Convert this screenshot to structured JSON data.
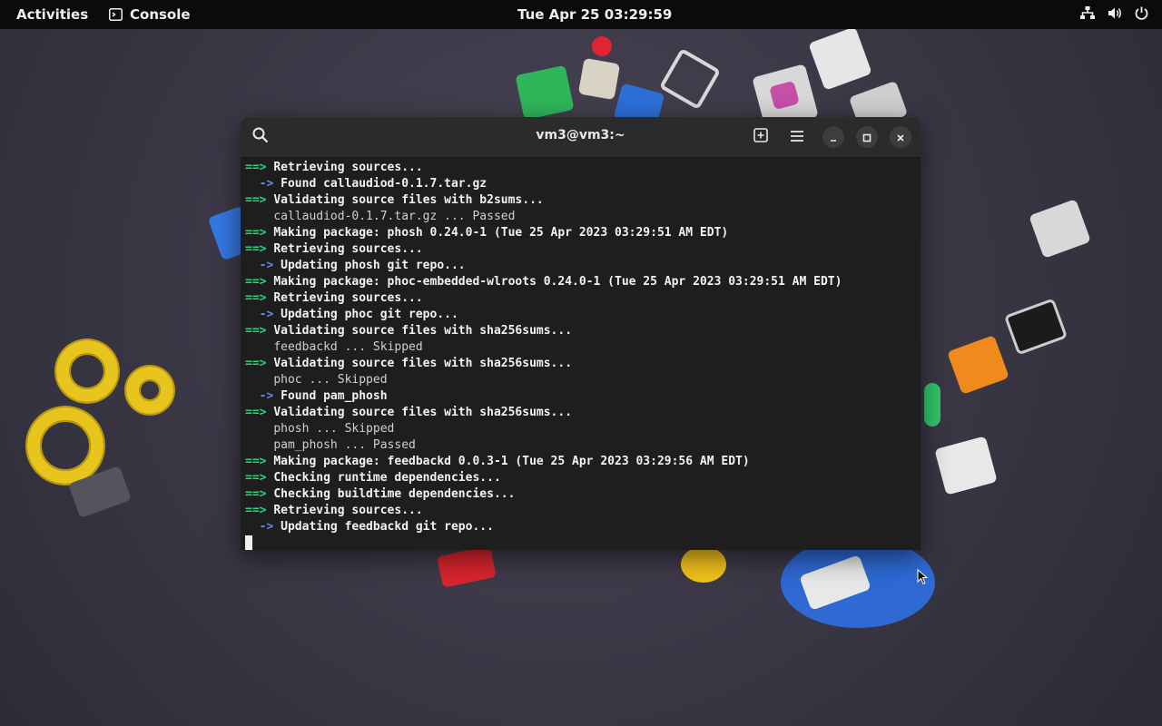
{
  "topbar": {
    "activities": "Activities",
    "app_name": "Console",
    "clock": "Tue Apr 25  03:29:59",
    "tray_icons": [
      "network-icon",
      "volume-icon",
      "power-icon"
    ]
  },
  "window": {
    "title": "vm3@vm3:~"
  },
  "terminal": {
    "lines": [
      {
        "marker": "==>",
        "type": "main",
        "text": "Retrieving sources..."
      },
      {
        "marker": "->",
        "type": "sub",
        "text": "Found callaudiod-0.1.7.tar.gz"
      },
      {
        "marker": "==>",
        "type": "main",
        "text": "Validating source files with b2sums..."
      },
      {
        "marker": "",
        "type": "plain",
        "text": "callaudiod-0.1.7.tar.gz ... Passed"
      },
      {
        "marker": "==>",
        "type": "main",
        "text": "Making package: phosh 0.24.0-1 (Tue 25 Apr 2023 03:29:51 AM EDT)"
      },
      {
        "marker": "==>",
        "type": "main",
        "text": "Retrieving sources..."
      },
      {
        "marker": "->",
        "type": "sub",
        "text": "Updating phosh git repo..."
      },
      {
        "marker": "==>",
        "type": "main",
        "text": "Making package: phoc-embedded-wlroots 0.24.0-1 (Tue 25 Apr 2023 03:29:51 AM EDT)"
      },
      {
        "marker": "==>",
        "type": "main",
        "text": "Retrieving sources..."
      },
      {
        "marker": "->",
        "type": "sub",
        "text": "Updating phoc git repo..."
      },
      {
        "marker": "==>",
        "type": "main",
        "text": "Validating source files with sha256sums..."
      },
      {
        "marker": "",
        "type": "plain",
        "text": "feedbackd ... Skipped"
      },
      {
        "marker": "==>",
        "type": "main",
        "text": "Validating source files with sha256sums..."
      },
      {
        "marker": "",
        "type": "plain",
        "text": "phoc ... Skipped"
      },
      {
        "marker": "->",
        "type": "sub",
        "text": "Found pam_phosh"
      },
      {
        "marker": "==>",
        "type": "main",
        "text": "Validating source files with sha256sums..."
      },
      {
        "marker": "",
        "type": "plain",
        "text": "phosh ... Skipped"
      },
      {
        "marker": "",
        "type": "plain",
        "text": "pam_phosh ... Passed"
      },
      {
        "marker": "==>",
        "type": "main",
        "text": "Making package: feedbackd 0.0.3-1 (Tue 25 Apr 2023 03:29:56 AM EDT)"
      },
      {
        "marker": "==>",
        "type": "main",
        "text": "Checking runtime dependencies..."
      },
      {
        "marker": "==>",
        "type": "main",
        "text": "Checking buildtime dependencies..."
      },
      {
        "marker": "==>",
        "type": "main",
        "text": "Retrieving sources..."
      },
      {
        "marker": "->",
        "type": "sub",
        "text": "Updating feedbackd git repo..."
      }
    ]
  },
  "colors": {
    "marker_main": "#33d17a",
    "marker_sub": "#5b8de6",
    "terminal_bg": "#1e1e1e",
    "headerbar_bg": "#2b2b2b"
  }
}
